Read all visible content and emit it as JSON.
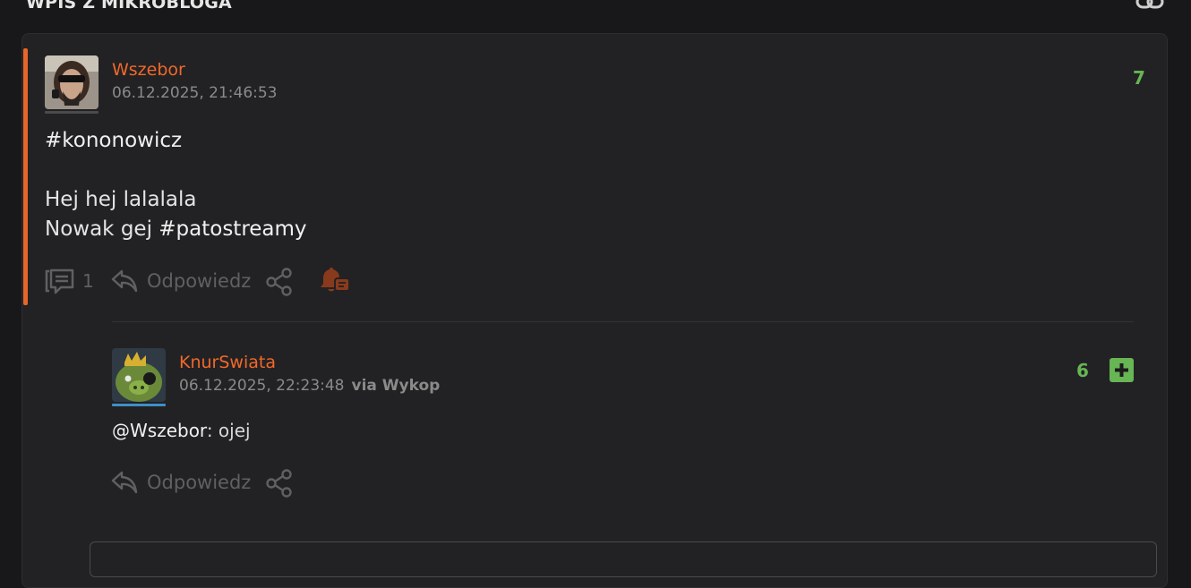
{
  "section": {
    "title": "WPIS Z MIKROBLOGA"
  },
  "post": {
    "author": "Wszebor",
    "date": "06.12.2025, 21:46:53",
    "votes": "7",
    "tag_line": "#kononowicz",
    "line1": "Hej hej lalalala",
    "line2_prefix": "Nowak gej ",
    "line2_tag": "#patostreamy",
    "comment_count": "1",
    "reply_label": "Odpowiedz"
  },
  "comment": {
    "author": "KnurSwiata",
    "date": "06.12.2025, 22:23:48",
    "via": "via Wykop",
    "votes": "6",
    "mention": "@Wszebor",
    "text": ": ojej",
    "reply_label": "Odpowiedz"
  },
  "colors": {
    "accent": "#e8662a",
    "author": "#f2682a",
    "vote": "#67b554"
  }
}
